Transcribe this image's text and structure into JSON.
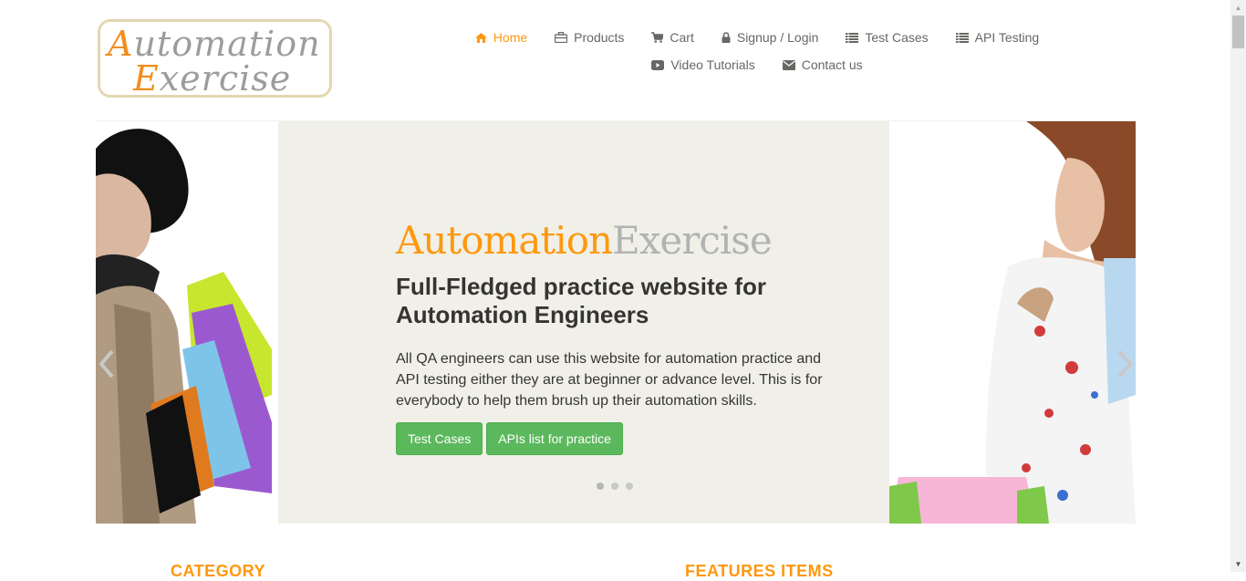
{
  "header": {
    "logo": {
      "line1_first": "A",
      "line1_rest": "utomation",
      "line2_first": "E",
      "line2_rest": "xercise"
    },
    "nav": [
      {
        "label": "Home",
        "icon": "home-icon",
        "active": true
      },
      {
        "label": "Products",
        "icon": "briefcase-icon"
      },
      {
        "label": "Cart",
        "icon": "shopping-cart-icon"
      },
      {
        "label": "Signup / Login",
        "icon": "lock-icon"
      },
      {
        "label": "Test Cases",
        "icon": "list-icon"
      },
      {
        "label": "API Testing",
        "icon": "list-icon"
      },
      {
        "label": "Video Tutorials",
        "icon": "youtube-play-icon"
      },
      {
        "label": "Contact us",
        "icon": "envelope-icon"
      }
    ]
  },
  "slider": {
    "brand_part1": "Automation",
    "brand_part2": "Exercise",
    "headline": "Full-Fledged practice website for Automation Engineers",
    "description": "All QA engineers can use this website for automation practice and API testing either they are at beginner or advance level. This is for everybody to help them brush up their automation skills.",
    "buttons": {
      "test_cases": "Test Cases",
      "apis_list": "APIs list for practice"
    },
    "indicators": 3,
    "active_indicator": 1
  },
  "sections": {
    "category_title": "CATEGORY",
    "features_title": "FEATURES ITEMS"
  },
  "colors": {
    "accent": "#fe980f",
    "brand_gray": "#b3b2b2",
    "button_green": "#5cb85c",
    "text_dark": "#363432",
    "nav_text": "#696763"
  }
}
